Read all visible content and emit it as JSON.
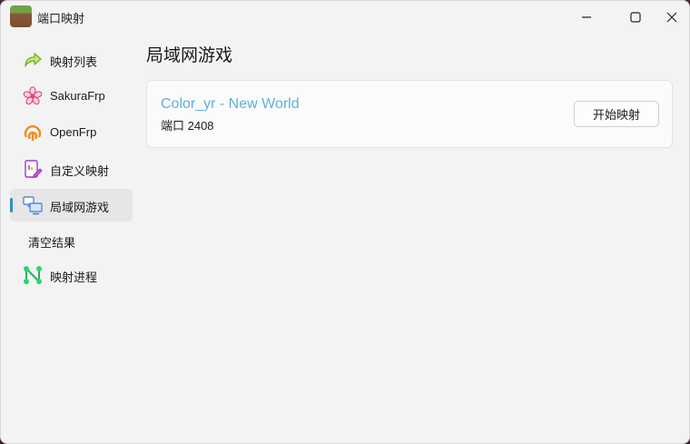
{
  "window": {
    "title": "端口映射"
  },
  "sidebar": {
    "items": [
      {
        "label": "映射列表",
        "icon": "arrow-forward-icon"
      },
      {
        "label": "SakuraFrp",
        "icon": "sakura-flower-icon"
      },
      {
        "label": "OpenFrp",
        "icon": "openfrp-logo-icon"
      },
      {
        "label": "自定义映射",
        "icon": "edit-document-icon"
      },
      {
        "label": "局域网游戏",
        "icon": "lan-computers-icon",
        "selected": true
      },
      {
        "label": "清空结果",
        "icon": ""
      },
      {
        "label": "映射进程",
        "icon": "network-nodes-icon"
      }
    ]
  },
  "page": {
    "title": "局域网游戏"
  },
  "games": [
    {
      "name": "Color_yr - New World",
      "port": "端口 2408",
      "action": "开始映射"
    }
  ],
  "colors": {
    "accent": "#2f8fc8",
    "game_title": "#5fb0d8"
  }
}
